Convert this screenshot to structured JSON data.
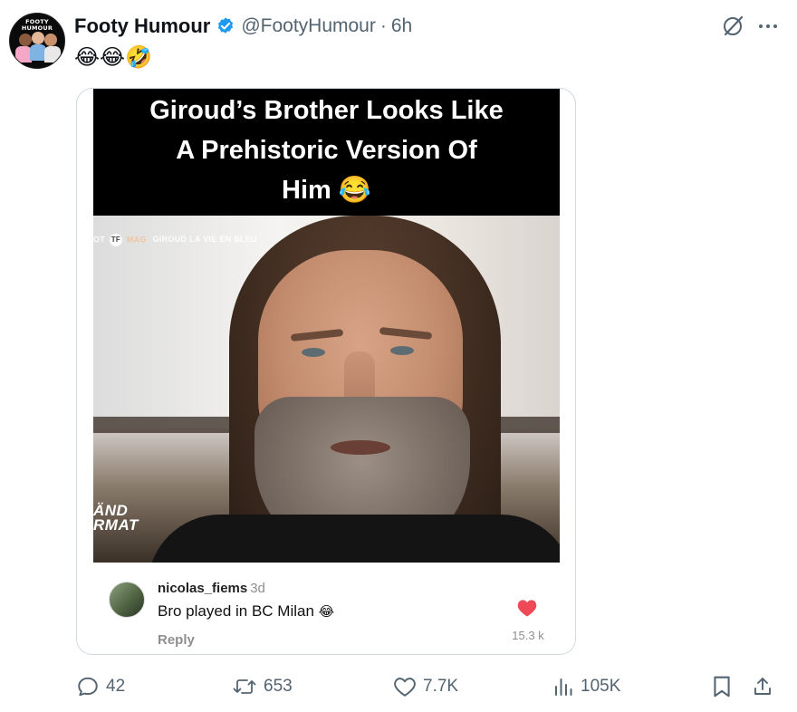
{
  "author": {
    "display_name": "Footy Humour",
    "handle": "@FootyHumour",
    "separator": "·",
    "time": "6h",
    "avatar_text": "FOOTY HUMOUR"
  },
  "tweet": {
    "text": "😂😂🤣"
  },
  "media": {
    "caption": "Giroud’s Brother Looks Like A Prehistoric Version Of Him 😂",
    "video_overlay_left": "OT",
    "video_overlay_logo": "TF",
    "video_overlay_mag": "MAG",
    "video_overlay_right": "GIROUD LA VIE EN BLEU",
    "video_corner_line1": "ÄND",
    "video_corner_line2": "RMAT"
  },
  "comment": {
    "username": "nicolas_fiems",
    "ago": "3d",
    "text": "Bro played in BC Milan",
    "emoji": "😂",
    "reply_label": "Reply",
    "like_count": "15.3 k"
  },
  "actions": {
    "replies": "42",
    "reposts": "653",
    "likes": "7.7K",
    "views": "105K"
  },
  "colors": {
    "verified": "#1d9bf0",
    "heart": "#ed4956",
    "muted": "#536471"
  },
  "icons": [
    "verified-badge-icon",
    "grok-icon",
    "more-icon",
    "reply-icon",
    "repost-icon",
    "like-icon",
    "views-icon",
    "bookmark-icon",
    "share-icon",
    "heart-icon"
  ]
}
